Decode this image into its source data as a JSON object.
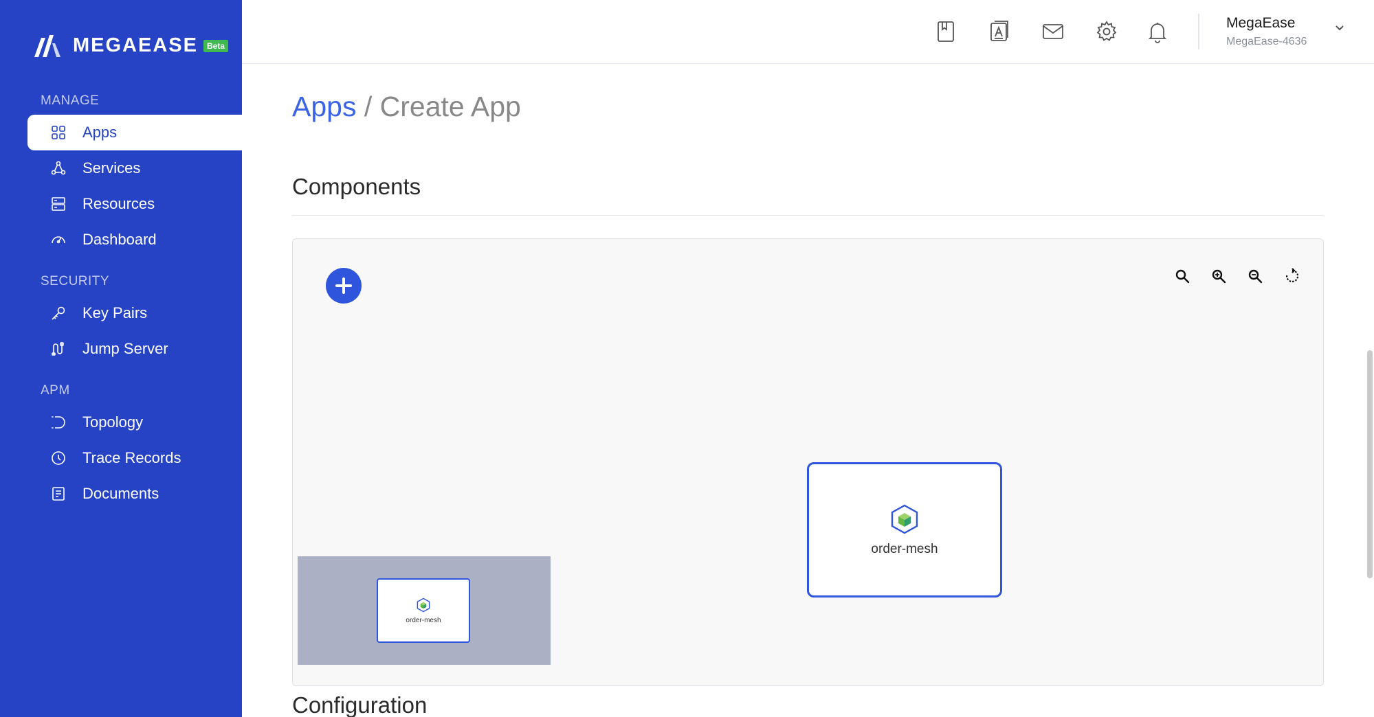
{
  "brand": {
    "name": "MEGAEASE",
    "badge": "Beta"
  },
  "sidebar": {
    "sections": [
      {
        "title": "MANAGE"
      },
      {
        "title": "SECURITY"
      },
      {
        "title": "APM"
      }
    ],
    "items": [
      {
        "label": "Apps",
        "icon": "grid-icon",
        "active": true
      },
      {
        "label": "Services",
        "icon": "services-icon"
      },
      {
        "label": "Resources",
        "icon": "server-icon"
      },
      {
        "label": "Dashboard",
        "icon": "gauge-icon"
      },
      {
        "label": "Key Pairs",
        "icon": "key-icon"
      },
      {
        "label": "Jump Server",
        "icon": "jump-server-icon"
      },
      {
        "label": "Topology",
        "icon": "topology-icon"
      },
      {
        "label": "Trace Records",
        "icon": "clock-icon"
      },
      {
        "label": "Documents",
        "icon": "document-icon"
      }
    ]
  },
  "header": {
    "icons": [
      "bookmark-icon",
      "text-document-icon",
      "mail-icon",
      "gear-icon",
      "bell-icon"
    ],
    "user": {
      "name": "MegaEase",
      "account": "MegaEase-4636"
    }
  },
  "main": {
    "breadcrumb": {
      "parent": "Apps",
      "separator": "/",
      "current": "Create App"
    },
    "components_heading": "Components",
    "configuration_heading": "Configuration",
    "canvas": {
      "toolbar": [
        "zoom-icon",
        "zoom-in-icon",
        "zoom-out-icon",
        "reset-icon"
      ],
      "node": {
        "label": "order-mesh"
      },
      "minimap": {
        "node_label": "order-mesh"
      }
    }
  },
  "colors": {
    "sidebar": "#2543c4",
    "accent": "#2f55dc",
    "link": "#3a63e6"
  }
}
